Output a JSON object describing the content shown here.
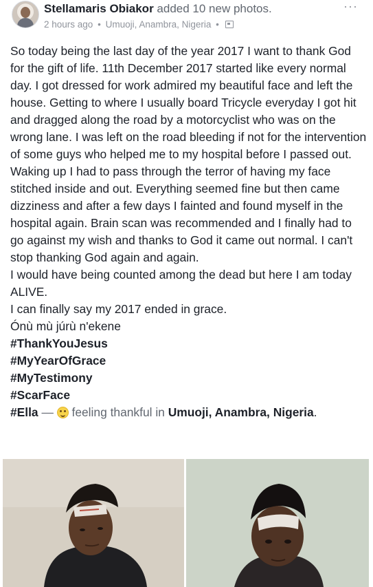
{
  "header": {
    "author": "Stellamaris Obiakor",
    "action": "added 10 new photos.",
    "time": "2 hours ago",
    "location": "Umuoji, Anambra, Nigeria",
    "separator": "•",
    "privacy_icon": "public-icon",
    "more_icon": "more-options-icon",
    "more_glyph": "···"
  },
  "post": {
    "body": "So today being the last day of the year 2017 I want to thank God for the gift of life. 11th December 2017 started like every normal day. I got dressed for work admired my beautiful face and left the house. Getting to where I usually board Tricycle everyday I got hit and dragged along the road by a motorcyclist who was on the wrong lane. I was left on the road bleeding if not for the intervention of some guys who helped me to my hospital before I passed out. Waking up I had to pass through the terror of having my face stitched inside and out. Everything seemed fine but then came dizziness and after a few days I fainted and found myself in the hospital again. Brain scan was recommended and I finally had to go against my wish and thanks to God it came out normal. I can't stop  thanking God again and again.",
    "line2": "I would have being counted among the dead but here I am today ALIVE.",
    "line3": "I can finally say my 2017 ended in grace.",
    "line4": "Ónù mù júrù n'ekene",
    "hashtags": [
      "#ThankYouJesus",
      "#MyYearOfGrace",
      "#MyTestimony",
      "#ScarFace"
    ],
    "feeling": {
      "tag": "#Ella",
      "dash": " — ",
      "emoji": "smiling-emoji",
      "text": " feeling thankful in ",
      "place": "Umuoji, Anambra, Nigeria",
      "end": "."
    }
  },
  "photos": [
    {
      "name": "photo-1",
      "icon": "person-with-forehead-bandage"
    },
    {
      "name": "photo-2",
      "icon": "person-with-forehead-bandage"
    }
  ]
}
